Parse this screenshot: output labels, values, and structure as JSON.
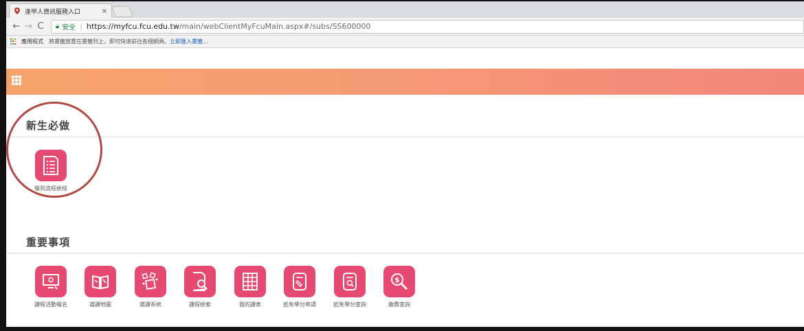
{
  "browser": {
    "tab_title": "逢甲人資訊服務入口",
    "tab_close": "×",
    "secure_label": "安全",
    "url_host": "https://myfcu.fcu.edu.tw",
    "url_path": "/main/webClientMyFcuMain.aspx#/subs/SS600000",
    "bookmarks_apps": "應用程式",
    "bookmarks_hint": "將書籤放置在書籤列上，即可快速前往各個網頁。",
    "bookmarks_link": "立即匯入書籤..."
  },
  "sections": {
    "freshman": {
      "title": "新生必做",
      "items": [
        {
          "label": "報到流程檢核",
          "icon": "checklist-icon"
        }
      ]
    },
    "important": {
      "title": "重要事項",
      "items": [
        {
          "label": "課程活動報名",
          "icon": "monitor-signup-icon"
        },
        {
          "label": "選課地圖",
          "icon": "map-book-icon"
        },
        {
          "label": "選課系統",
          "icon": "scatter-cards-icon"
        },
        {
          "label": "課程檢索",
          "icon": "document-search-icon"
        },
        {
          "label": "我的課表",
          "icon": "timetable-icon"
        },
        {
          "label": "抵免學分申請",
          "icon": "credit-apply-icon"
        },
        {
          "label": "抵免學分查詢",
          "icon": "credit-query-icon"
        },
        {
          "label": "繳費查詢",
          "icon": "payment-search-icon"
        }
      ]
    }
  },
  "colors": {
    "accent": "#e64a73",
    "header_start": "#f6a36b",
    "header_end": "#f2877a",
    "annotation_circle": "#b04a44"
  }
}
